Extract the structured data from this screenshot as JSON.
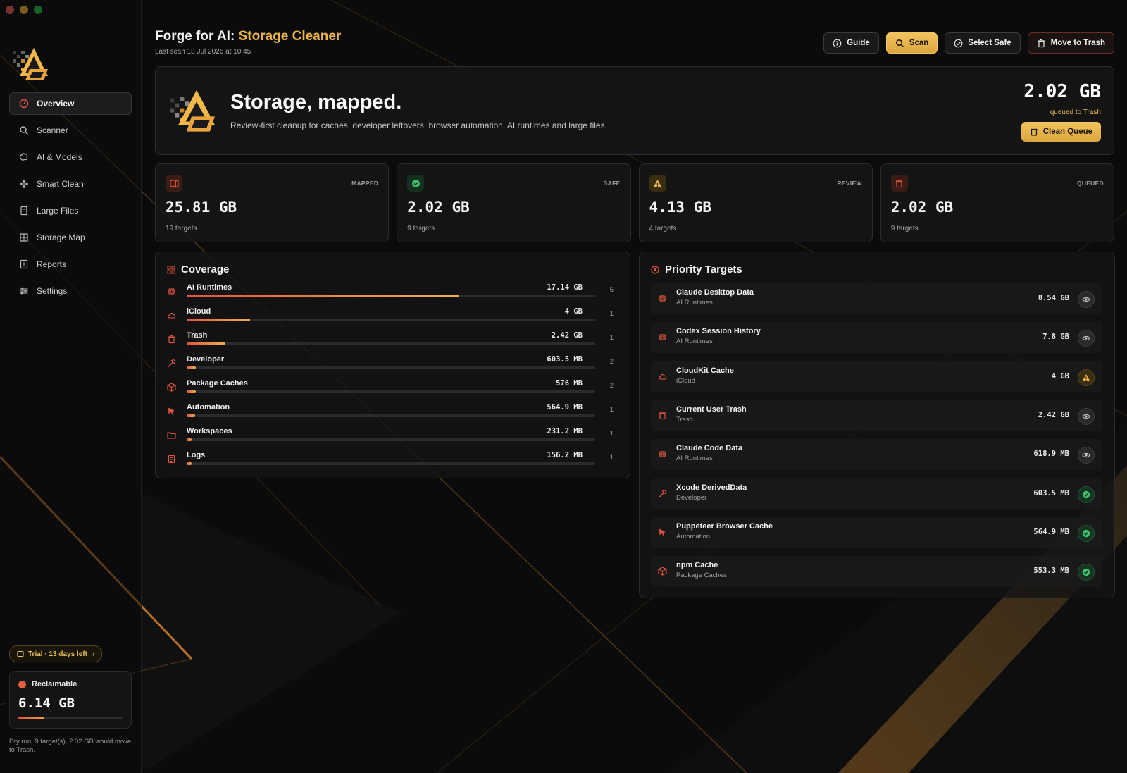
{
  "window": {
    "traffic_colors": [
      "#ff5f57",
      "#febc2e",
      "#28c840"
    ]
  },
  "header": {
    "title_prefix": "Forge for AI:",
    "title_accent": "Storage Cleaner",
    "last_scan": "Last scan 18 Jul 2026 at 10:45"
  },
  "toolbar": {
    "guide": "Guide",
    "scan": "Scan",
    "select_safe": "Select Safe",
    "move_to_trash": "Move to Trash"
  },
  "sidebar": {
    "items": [
      {
        "label": "Overview",
        "icon": "gauge-icon"
      },
      {
        "label": "Scanner",
        "icon": "search-icon"
      },
      {
        "label": "AI & Models",
        "icon": "brain-icon"
      },
      {
        "label": "Smart Clean",
        "icon": "sparkles-icon"
      },
      {
        "label": "Large Files",
        "icon": "file-icon"
      },
      {
        "label": "Storage Map",
        "icon": "grid-icon"
      },
      {
        "label": "Reports",
        "icon": "report-icon"
      },
      {
        "label": "Settings",
        "icon": "sliders-icon"
      }
    ],
    "active_index": 0,
    "trial": "Trial · 13 days left",
    "reclaimable_label": "Reclaimable",
    "reclaimable_value": "6.14 GB",
    "reclaimable_progress": 0.24,
    "dry_run": "Dry run: 9 target(s), 2.02 GB would move to Trash."
  },
  "hero": {
    "heading": "Storage, mapped.",
    "subtitle": "Review-first cleanup for caches, developer leftovers, browser automation, AI runtimes and large files.",
    "queued_value": "2.02 GB",
    "queued_label": "queued to Trash",
    "clean_queue": "Clean Queue"
  },
  "stats": [
    {
      "label": "MAPPED",
      "value": "25.81 GB",
      "sub": "19 targets",
      "icon": "map-icon",
      "color": "#e2553c"
    },
    {
      "label": "SAFE",
      "value": "2.02 GB",
      "sub": "9 targets",
      "icon": "check-badge-icon",
      "color": "#3fbf6a"
    },
    {
      "label": "REVIEW",
      "value": "4.13 GB",
      "sub": "4 targets",
      "icon": "warning-icon",
      "color": "#ecb44a"
    },
    {
      "label": "QUEUED",
      "value": "2.02 GB",
      "sub": "9 targets",
      "icon": "trash-icon",
      "color": "#e2553c"
    }
  ],
  "coverage": {
    "title": "Coverage",
    "rows": [
      {
        "name": "AI Runtimes",
        "size": "17.14 GB",
        "count": "5",
        "fraction": 0.665,
        "icon": "chip-icon"
      },
      {
        "name": "iCloud",
        "size": "4 GB",
        "count": "1",
        "fraction": 0.155,
        "icon": "cloud-icon"
      },
      {
        "name": "Trash",
        "size": "2.42 GB",
        "count": "1",
        "fraction": 0.094,
        "icon": "trash-icon"
      },
      {
        "name": "Developer",
        "size": "603.5 MB",
        "count": "2",
        "fraction": 0.023,
        "icon": "hammer-icon"
      },
      {
        "name": "Package Caches",
        "size": "576 MB",
        "count": "2",
        "fraction": 0.022,
        "icon": "box-icon"
      },
      {
        "name": "Automation",
        "size": "564.9 MB",
        "count": "1",
        "fraction": 0.021,
        "icon": "cursor-icon"
      },
      {
        "name": "Workspaces",
        "size": "231.2 MB",
        "count": "1",
        "fraction": 0.009,
        "icon": "folder-icon"
      },
      {
        "name": "Logs",
        "size": "156.2 MB",
        "count": "1",
        "fraction": 0.006,
        "icon": "log-icon"
      }
    ]
  },
  "priority": {
    "title": "Priority Targets",
    "rows": [
      {
        "name": "Claude Desktop Data",
        "category": "AI Runtimes",
        "size": "8.54 GB",
        "status": "review",
        "icon": "chip-icon"
      },
      {
        "name": "Codex Session History",
        "category": "AI Runtimes",
        "size": "7.8 GB",
        "status": "review",
        "icon": "chip-icon"
      },
      {
        "name": "CloudKit Cache",
        "category": "iCloud",
        "size": "4 GB",
        "status": "warn",
        "icon": "cloud-icon"
      },
      {
        "name": "Current User Trash",
        "category": "Trash",
        "size": "2.42 GB",
        "status": "review",
        "icon": "trash-icon"
      },
      {
        "name": "Claude Code Data",
        "category": "AI Runtimes",
        "size": "618.9 MB",
        "status": "review",
        "icon": "chip-icon"
      },
      {
        "name": "Xcode DerivedData",
        "category": "Developer",
        "size": "603.5 MB",
        "status": "safe",
        "icon": "hammer-icon"
      },
      {
        "name": "Puppeteer Browser Cache",
        "category": "Automation",
        "size": "564.9 MB",
        "status": "safe",
        "icon": "cursor-icon"
      },
      {
        "name": "npm Cache",
        "category": "Package Caches",
        "size": "553.3 MB",
        "status": "safe",
        "icon": "box-icon"
      }
    ]
  },
  "colors": {
    "accent": "#ecb44a",
    "danger": "#e2553c",
    "safe": "#3fbf6a"
  }
}
